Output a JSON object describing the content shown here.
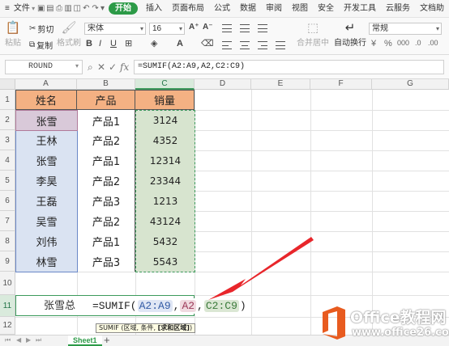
{
  "menubar": {
    "menu_icon": "≡",
    "file": "文件",
    "tabs": [
      "开始",
      "插入",
      "页面布局",
      "公式",
      "数据",
      "审阅",
      "视图",
      "安全",
      "开发工具",
      "云服务",
      "文档助"
    ]
  },
  "ribbon": {
    "paste": "粘贴",
    "cut": "剪切",
    "copy": "复制",
    "format_painter": "格式刷",
    "font_name": "宋体",
    "font_size": "16",
    "merge_center": "合并居中",
    "wrap_text": "自动换行",
    "number_format": "常规"
  },
  "formula_bar": {
    "name_box": "ROUND",
    "cancel_icon": "✕",
    "confirm_icon": "✓",
    "fx_label": "fx",
    "formula": "=SUMIF(A2:A9,A2,C2:C9)"
  },
  "grid": {
    "columns": [
      "A",
      "B",
      "C",
      "D",
      "E",
      "F",
      "G"
    ],
    "rows": [
      "1",
      "2",
      "3",
      "4",
      "5",
      "6",
      "7",
      "8",
      "9",
      "10",
      "11",
      "12"
    ],
    "header": [
      "姓名",
      "产品",
      "销量"
    ],
    "data": [
      [
        "张雪",
        "产品1",
        "3124"
      ],
      [
        "王林",
        "产品2",
        "4352"
      ],
      [
        "张雪",
        "产品1",
        "12314"
      ],
      [
        "李昊",
        "产品2",
        "23344"
      ],
      [
        "王磊",
        "产品3",
        "1213"
      ],
      [
        "吴雪",
        "产品2",
        "43124"
      ],
      [
        "刘伟",
        "产品1",
        "5432"
      ],
      [
        "林雪",
        "产品3",
        "5543"
      ]
    ],
    "row11_label": "张雪总",
    "editing_formula": {
      "prefix": "=SUMIF(",
      "arg1": "A2:A9",
      "sep1": ",",
      "arg2": "A2",
      "sep2": ",",
      "arg3": "C2:C9",
      "suffix": ")"
    },
    "tooltip_plain": "SUMIF (区域, 条件, ",
    "tooltip_bold": "[求和区域]",
    "tooltip_end": ")"
  },
  "sheets": {
    "active": "Sheet1",
    "add": "+"
  },
  "watermark": {
    "line1": "Office教程网",
    "line2": "www.office26.com"
  },
  "colors": {
    "accent_green": "#2c9a47",
    "header_fill": "#f4b183",
    "ref_blue": "#dae3f2",
    "ref_pink": "#d9c9d9",
    "ref_green": "#d7e4cf",
    "arrow_red": "#e8262b",
    "logo_orange": "#e85b1f"
  }
}
